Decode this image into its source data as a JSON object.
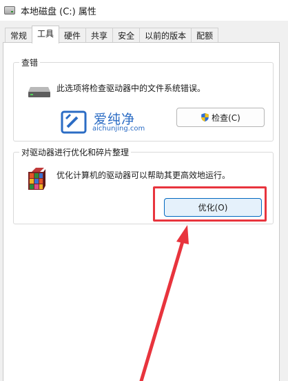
{
  "window": {
    "title": "本地磁盘 (C:) 属性"
  },
  "tabs": [
    {
      "label": "常规"
    },
    {
      "label": "工具"
    },
    {
      "label": "硬件"
    },
    {
      "label": "共享"
    },
    {
      "label": "安全"
    },
    {
      "label": "以前的版本"
    },
    {
      "label": "配额"
    }
  ],
  "active_tab": "工具",
  "error_checking": {
    "title": "查错",
    "description": "此选项将检查驱动器中的文件系统错误。",
    "button_label": "检查(C)"
  },
  "optimize": {
    "title": "对驱动器进行优化和碎片整理",
    "description": "优化计算机的驱动器可以帮助其更高效地运行。",
    "button_label": "优化(O)"
  },
  "watermark": {
    "text": "爱纯净",
    "url": "aichunjing.com"
  },
  "colors": {
    "annotation": "#e8343d",
    "primary_button_border": "#0067c0",
    "watermark": "#2b6cc4"
  }
}
